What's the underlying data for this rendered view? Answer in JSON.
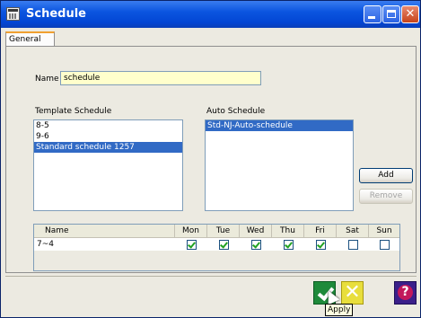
{
  "window": {
    "title": "Schedule",
    "icon": "calendar-icon"
  },
  "tabs": [
    {
      "label": "General",
      "active": true
    }
  ],
  "name": {
    "label": "Name",
    "value": "schedule"
  },
  "template_schedule": {
    "label": "Template Schedule",
    "items": [
      {
        "label": "8-5",
        "selected": false
      },
      {
        "label": "9-6",
        "selected": false
      },
      {
        "label": "Standard schedule 1257",
        "selected": true
      }
    ]
  },
  "auto_schedule": {
    "label": "Auto Schedule",
    "items": [
      {
        "label": "Std-NJ-Auto-schedule",
        "selected": true
      }
    ]
  },
  "buttons": {
    "add": "Add",
    "remove": "Remove"
  },
  "table": {
    "headers": [
      "Name",
      "Mon",
      "Tue",
      "Wed",
      "Thu",
      "Fri",
      "Sat",
      "Sun"
    ],
    "rows": [
      {
        "name": "7~4",
        "days": [
          true,
          true,
          true,
          true,
          true,
          false,
          false
        ]
      }
    ]
  },
  "footer": {
    "tooltip": "Apply",
    "ok_icon": "check-icon",
    "cancel_icon": "x-icon",
    "help_icon": "question-icon"
  },
  "colors": {
    "titlebar": "#0b55e0",
    "selection": "#316ac5",
    "name_field_bg": "#ffffcc",
    "ok": "#1e8a3a",
    "cancel": "#e8de3c",
    "help": "#3b1f8a"
  }
}
